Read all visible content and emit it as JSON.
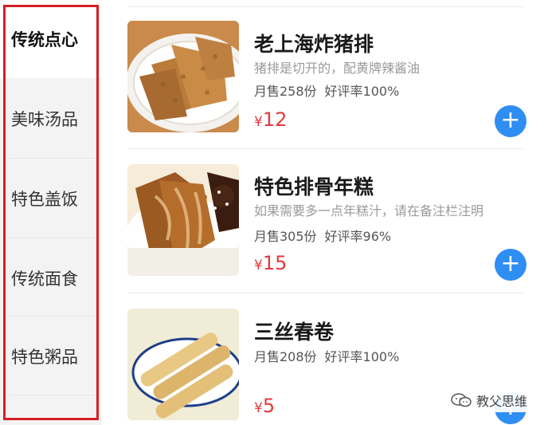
{
  "sidebar": {
    "categories": [
      {
        "label": "传统点心",
        "active": true
      },
      {
        "label": "美味汤品",
        "active": false
      },
      {
        "label": "特色盖饭",
        "active": false
      },
      {
        "label": "传统面食",
        "active": false
      },
      {
        "label": "特色粥品",
        "active": false
      }
    ]
  },
  "items": [
    {
      "name": "老上海炸猪排",
      "desc": "猪排是切开的，配黄牌辣酱油",
      "sales": "月售258份",
      "rating": "好评率100%",
      "currency": "¥",
      "price": "12",
      "add_label": "+"
    },
    {
      "name": "特色排骨年糕",
      "desc": "如果需要多一点年糕汁，请在备注栏注明",
      "sales": "月售305份",
      "rating": "好评率96%",
      "currency": "¥",
      "price": "15",
      "add_label": "+"
    },
    {
      "name": "三丝春卷",
      "sales": "月售208份",
      "rating": "好评率100%",
      "currency": "¥",
      "price": "5",
      "add_label": "+"
    }
  ],
  "watermark": {
    "text": "教父思维",
    "icon": "wechat-icon"
  },
  "colors": {
    "accent": "#2f8ef4",
    "price": "#e4393c",
    "highlight_frame": "#d51f24"
  }
}
